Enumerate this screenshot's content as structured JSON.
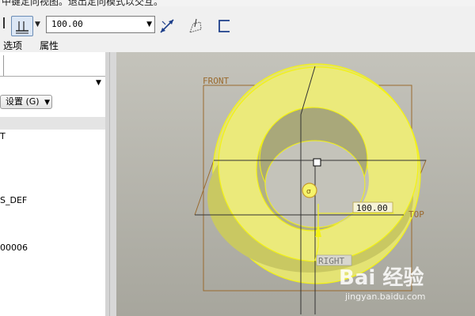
{
  "hint": {
    "text": "中键定向视图。退出定向模式以交互。"
  },
  "toolbar": {
    "value": "100.00",
    "depth_button": "depth-options",
    "flip_icon": "flip-direction-icon",
    "sketch_icon": "sketch-icon",
    "bracket_icon": "open-rectangle-icon"
  },
  "menu": {
    "options": "选项",
    "properties": "属性"
  },
  "panel": {
    "settings_label": "设置 (G)",
    "items": [
      "T",
      "S_DEF",
      "00006"
    ]
  },
  "viewport": {
    "labels": {
      "front": "FRONT",
      "top": "TOP",
      "right": "RIGHT",
      "dimension": "100.00"
    },
    "colors": {
      "model_fill": "#e9e87a",
      "model_edge": "#f5f517",
      "datum": "#9a6a2e",
      "background": "#b6b5ad"
    }
  },
  "watermark": {
    "logo": "Bai 经验",
    "url": "jingyan.baidu.com"
  }
}
